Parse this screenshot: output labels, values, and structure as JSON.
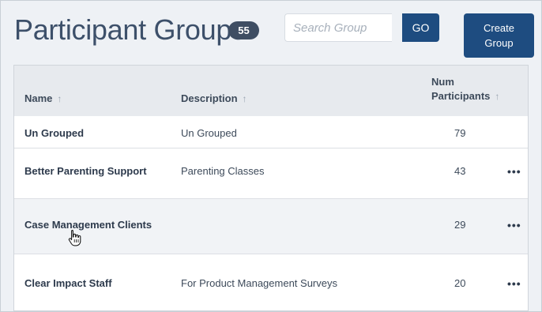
{
  "header": {
    "title": "Participant Groups",
    "group_count": "55"
  },
  "search": {
    "placeholder": "Search Group",
    "value": "",
    "go_label": "GO"
  },
  "create_button": {
    "line1": "Create",
    "line2": "Group"
  },
  "table": {
    "columns": {
      "name": "Name",
      "description": "Description",
      "participants_line1": "Num",
      "participants_line2": "Participants"
    },
    "sort_icon": "↑",
    "rows": [
      {
        "name": "Un Grouped",
        "description": "Un Grouped",
        "participants": "79",
        "has_menu": false
      },
      {
        "name": "Better Parenting Support",
        "description": "Parenting Classes",
        "participants": "43",
        "has_menu": true
      },
      {
        "name": "Case Management Clients",
        "description": "",
        "participants": "29",
        "has_menu": true
      },
      {
        "name": "Clear Impact Staff",
        "description": "For Product Management Surveys",
        "participants": "20",
        "has_menu": true
      }
    ],
    "menu_glyph": "•••"
  },
  "colors": {
    "accent": "#1e4c80",
    "badge": "#3f4e63",
    "title": "#3d506a"
  },
  "icons": {
    "sort": "sort-ascending-icon",
    "row_menu": "more-horizontal-icon",
    "cursor": "hand-pointer-icon"
  }
}
